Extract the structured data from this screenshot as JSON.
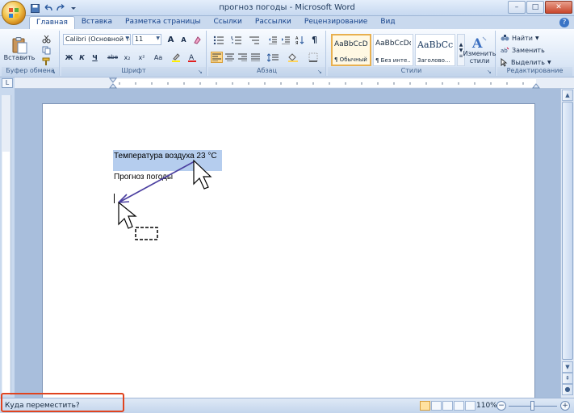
{
  "window": {
    "title": "прогноз погоды - Microsoft Word",
    "minimize": "–",
    "maximize": "□",
    "close": "✕"
  },
  "tabs": [
    {
      "label": "Главная"
    },
    {
      "label": "Вставка"
    },
    {
      "label": "Разметка страницы"
    },
    {
      "label": "Ссылки"
    },
    {
      "label": "Рассылки"
    },
    {
      "label": "Рецензирование"
    },
    {
      "label": "Вид"
    }
  ],
  "ribbon": {
    "clipboard": {
      "label": "Буфер обмена",
      "paste_label": "Вставить"
    },
    "font": {
      "label": "Шрифт",
      "font_name": "Calibri (Основной те",
      "font_size": "11",
      "bold": "Ж",
      "italic": "К",
      "underline": "Ч",
      "strike": "abe",
      "subscript": "x₂",
      "superscript": "x²",
      "case": "Aa",
      "grow": "A",
      "shrink": "A"
    },
    "paragraph": {
      "label": "Абзац",
      "pilcrow": "¶"
    },
    "styles": {
      "label": "Стили",
      "items": [
        {
          "preview": "AaBbCcDc",
          "name": "¶ Обычный"
        },
        {
          "preview": "AaBbCcDc",
          "name": "¶ Без инте..."
        },
        {
          "preview": "AaBbCc",
          "name": "Заголово..."
        }
      ],
      "change_label_1": "Изменить",
      "change_label_2": "стили"
    },
    "editing": {
      "label": "Редактирование",
      "find": "Найти",
      "replace": "Заменить",
      "select": "Выделить"
    }
  },
  "ruler": {
    "corner": "L"
  },
  "document": {
    "line1": "Температура воздуха 23 °С",
    "line2": "Прогноз погоды"
  },
  "status": {
    "message": "Куда переместить?",
    "zoom": "110%",
    "zoom_minus": "−",
    "zoom_plus": "+",
    "zoom_level": 0.5
  },
  "colors": {
    "accent": "#15428b",
    "selection": "#b5cdee",
    "highlight_box": "#e0441f",
    "drag_arrow": "#4b3fa0"
  }
}
